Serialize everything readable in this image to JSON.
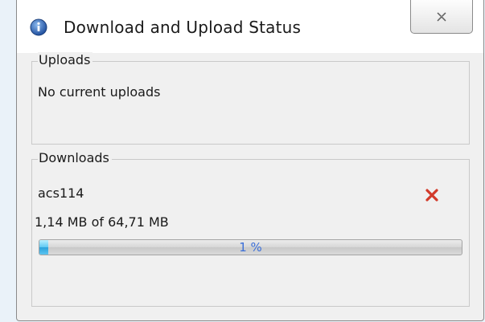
{
  "window": {
    "title": "Download and Upload Status"
  },
  "uploads": {
    "legend": "Uploads",
    "status_text": "No current uploads"
  },
  "downloads": {
    "legend": "Downloads",
    "items": [
      {
        "name": "acs114",
        "size_text": "1,14 MB of 64,71 MB",
        "progress_label": "1 %",
        "progress_fraction": 0.01,
        "cancel_icon": "red-x-icon"
      }
    ]
  },
  "colors": {
    "cancel": "#d23a2a",
    "progress_text": "#3b6fd8",
    "title_icon": "#2d62b3"
  },
  "icons": {
    "title": "info-globe-icon",
    "close": "close-icon"
  }
}
